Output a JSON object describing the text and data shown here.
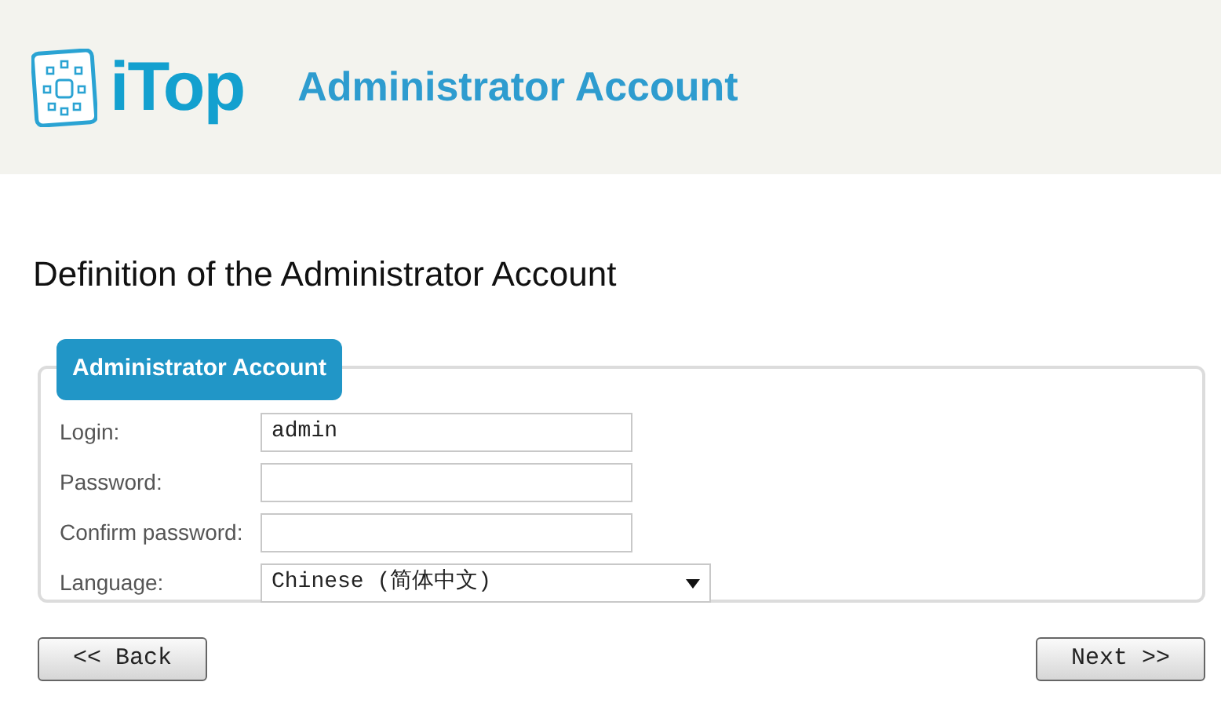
{
  "header": {
    "logo_text": "iTop",
    "title": "Administrator Account"
  },
  "page_title": "Definition of the Administrator Account",
  "fieldset": {
    "legend": "Administrator Account",
    "fields": [
      {
        "kind": "text",
        "label": "Login:",
        "value": "admin"
      },
      {
        "kind": "password",
        "label": "Password:"
      },
      {
        "kind": "password",
        "label": "Confirm password:"
      },
      {
        "kind": "select",
        "label": "Language:",
        "value": "Chinese (简体中文)"
      }
    ]
  },
  "buttons": [
    {
      "label": "<< Back"
    },
    {
      "label": "Next >>"
    }
  ]
}
